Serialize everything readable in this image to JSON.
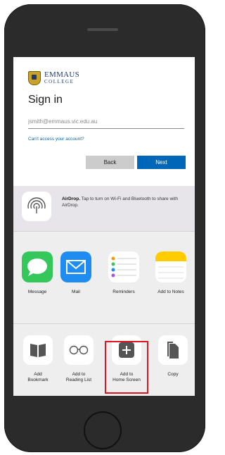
{
  "login": {
    "logo_main": "EMMAUS",
    "logo_sub": "COLLEGE",
    "title": "Sign in",
    "email_value": "jsmith@emmaus.vic.edu.au",
    "cant_access": "Can't access your account?",
    "back_label": "Back",
    "next_label": "Next",
    "colors": {
      "next": "#0067b8",
      "back": "#cccccc",
      "link": "#0067b8"
    }
  },
  "share_sheet": {
    "airdrop_title": "AirDrop.",
    "airdrop_text": "Tap to turn on Wi-Fi and Bluetooth to share with AirDrop.",
    "apps": [
      {
        "label": "Message",
        "icon": "message-icon"
      },
      {
        "label": "Mail",
        "icon": "mail-icon"
      },
      {
        "label": "Reminders",
        "icon": "reminders-icon"
      },
      {
        "label": "Add to Notes",
        "icon": "notes-icon"
      }
    ],
    "actions": [
      {
        "label_line1": "Add",
        "label_line2": "Bookmark",
        "icon": "book-icon"
      },
      {
        "label_line1": "Add to",
        "label_line2": "Reading List",
        "icon": "glasses-icon"
      },
      {
        "label_line1": "Add to",
        "label_line2": "Home Screen",
        "icon": "plus-icon"
      },
      {
        "label_line1": "Copy",
        "label_line2": "",
        "icon": "copy-icon"
      }
    ],
    "highlight_color": "#e0141e"
  }
}
